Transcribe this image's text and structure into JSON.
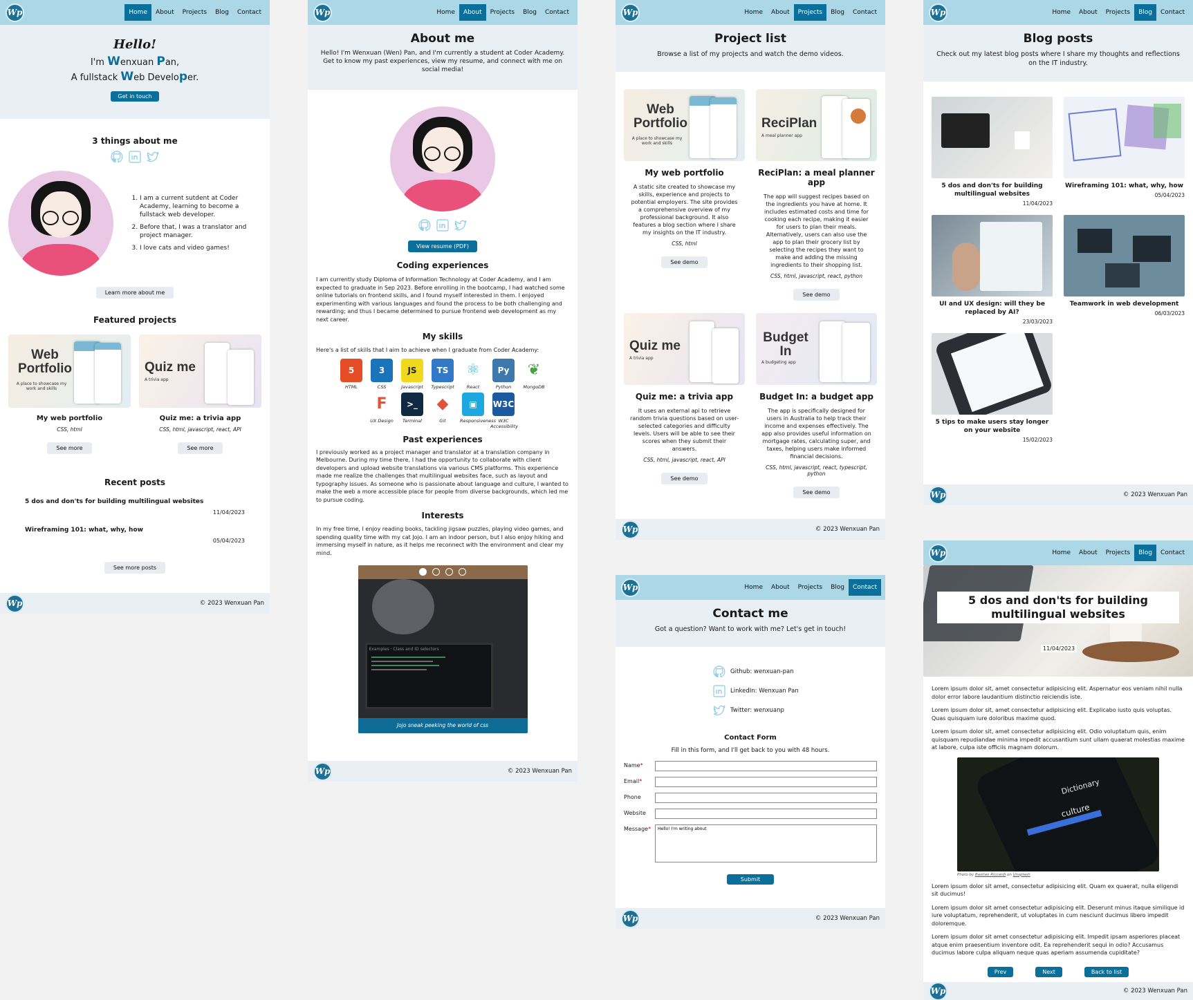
{
  "nav": {
    "home": "Home",
    "about": "About",
    "projects": "Projects",
    "blog": "Blog",
    "contact": "Contact",
    "logo": "Wp"
  },
  "footer_text": "© 2023 Wenxuan Pan",
  "home": {
    "hello": "Hello!",
    "line1_pre": "I'm ",
    "line1_W": "W",
    "line1_mid": "enxuan ",
    "line1_P": "P",
    "line1_post": "an,",
    "line2_pre": "A fullstack ",
    "line2_W": "W",
    "line2_mid": "eb Develo",
    "line2_P": "p",
    "line2_post": "er.",
    "cta": "Get in touch",
    "things_title": "3 things about me",
    "things": [
      "I am a current sutdent at Coder Academy, learning to become a fullstack web developer.",
      "Before that, I was a translator and project manager.",
      "I love cats and video games!"
    ],
    "learn_more": "Learn more about me",
    "featured_title": "Featured projects",
    "featured": [
      {
        "img_title": "Web Portfolio",
        "img_tag": "A place to showcase my work and skills",
        "name": "My web portfolio",
        "tech": "CSS, html",
        "btn": "See more"
      },
      {
        "img_title": "Quiz me",
        "img_tag": "A trivia app",
        "name": "Quiz me: a trivia app",
        "tech": "CSS, html, javascript, react, API",
        "btn": "See more"
      }
    ],
    "recent_title": "Recent posts",
    "recent": [
      {
        "title": "5 dos and don'ts for building multilingual websites",
        "date": "11/04/2023"
      },
      {
        "title": "Wireframing 101: what, why, how",
        "date": "05/04/2023"
      }
    ],
    "see_more_posts": "See more posts"
  },
  "about": {
    "title": "About me",
    "intro": "Hello! I'm Wenxuan (Wen) Pan, and I'm currently a student at Coder Academy. Get to know my past experiences, view my resume, and connect with me on social media!",
    "resume_btn": "View resume (PDF)",
    "coding_title": "Coding experiences",
    "coding_text": "I am currently study Diploma of Information Technology at Coder Academy, and I am expected to graduate in Sep 2023. Before enrolling in the bootcamp, I had watched some online tutorials on frontend skills, and I found myself interested in them. I enjoyed experimenting with various languages and found the process to be both challenging and rewarding; and thus I became determined to pursue frontend web development as my next career.",
    "skills_title": "My skills",
    "skills_intro": "Here's a list of skills that I aim to achieve when I graduate from Coder Academy:",
    "skills": [
      {
        "label": "HTML",
        "glyph": "5",
        "color": "#e44d26"
      },
      {
        "label": "CSS",
        "glyph": "3",
        "color": "#1b73ba"
      },
      {
        "label": "Javascript",
        "glyph": "JS",
        "color": "#f0d81d"
      },
      {
        "label": "Typescript",
        "glyph": "TS",
        "color": "#3178c6"
      },
      {
        "label": "React",
        "glyph": "⚛",
        "color": "#ffffff"
      },
      {
        "label": "Python",
        "glyph": "Py",
        "color": "#3d78aa"
      },
      {
        "label": "MongoDB",
        "glyph": "❦",
        "color": "#ffffff"
      },
      {
        "label": "UX Design",
        "glyph": "F",
        "color": "#ffffff"
      },
      {
        "label": "Terminal",
        "glyph": ">_",
        "color": "#102a43"
      },
      {
        "label": "Git",
        "glyph": "◆",
        "color": "#ffffff"
      },
      {
        "label": "Responsiveness",
        "glyph": "▣",
        "color": "#1fa7e0"
      },
      {
        "label": "W3C Accessibility",
        "glyph": "W3C",
        "color": "#1c5aa0"
      }
    ],
    "past_title": "Past experiences",
    "past_text": "I previously worked as a project manager and translator at a translation company in Melbourne. During my time there, I had the opportunity to collaborate with client developers and upload website translations via various CMS platforms. This experience made me realize the challenges that multilingual websites face, such as layout and typography issues. As someone who is passionate about language and culture, I wanted to make the web a more accessible place for people from diverse backgrounds, which led me to pursue coding.",
    "interests_title": "Interests",
    "interests_text": "In my free time, I enjoy reading books, tackling jigsaw puzzles, playing video games, and spending quality time with my cat Jojo. I am an indoor person, but I also enjoy hiking and immersing myself in nature, as it helps me reconnect with the environment and clear my mind.",
    "caption": "Jojo sneak peeking the world of css",
    "photo_screen_text": "Examples · Class and ID selectors"
  },
  "projects": {
    "title": "Project list",
    "sub": "Browse a list of my projects and watch the demo videos.",
    "items": [
      {
        "img_title": "Web Portfolio",
        "img_tag": "A place to showcase my work and skills",
        "name": "My web portfolio",
        "desc": "A static site created to showcase my skills, experience and projects to potential employers. The site provides a comprehensive overview of my professional background. It also features a blog section where I share my insights on the IT industry.",
        "tech": "CSS, html",
        "btn": "See demo"
      },
      {
        "img_title": "ReciPlan",
        "img_tag": "A meal planner app",
        "name": "ReciPlan: a meal planner app",
        "desc": "The app will suggest recipes based on the ingredients you have at home. It includes estimated costs and time for cooking each recipe, making it easier for users to plan their meals. Alternatively, users can also use the app to plan their grocery list by selecting the recipes they want to make and adding the missing ingredients to their shopping list.",
        "tech": "CSS, html, javascript, react, python",
        "btn": "See demo"
      },
      {
        "img_title": "Quiz me",
        "img_tag": "A trivia app",
        "name": "Quiz me: a trivia app",
        "desc": "It uses an external api to retrieve random trivia questions based on user-selected categories and difficulty levels. Users will be able to see their scores when they submit their answers.",
        "tech": "CSS, html, javascript, react, API",
        "btn": "See demo"
      },
      {
        "img_title": "Budget In",
        "img_tag": "A budgeting app",
        "name": "Budget In: a budget app",
        "desc": "The app is specifically designed for users in Australia to help track their income and expenses effectively. The app also provides useful information on mortgage rates, calculating super, and taxes, helping users make informed financial decisions.",
        "tech": "CSS, html, javascript, react, typescript, python",
        "btn": "See demo"
      }
    ]
  },
  "contact": {
    "title": "Contact me",
    "sub": "Got a question? Want to work with me? Let's get in touch!",
    "github": "Github: wenxuan-pan",
    "linkedin": "LinkedIn: Wenxuan Pan",
    "twitter": "Twitter: wenxuanp",
    "form_title": "Contact Form",
    "form_sub": "Fill in this form, and I'll get back to you with 48 hours.",
    "name": "Name",
    "email": "Email",
    "phone": "Phone",
    "website": "Website",
    "message": "Message",
    "message_value": "Hello! I'm writing about",
    "submit": "Submit"
  },
  "blog": {
    "title": "Blog posts",
    "sub": "Check out my latest blog posts where I share my thoughts and reflections on the IT industry.",
    "posts": [
      {
        "title": "5 dos and don'ts for building multilingual websites",
        "date": "11/04/2023"
      },
      {
        "title": "Wireframing 101: what, why, how",
        "date": "05/04/2023"
      },
      {
        "title": "UI and UX design: will they be replaced by AI?",
        "date": "23/03/2023"
      },
      {
        "title": "Teamwork in web development",
        "date": "06/03/2023"
      },
      {
        "title": "5 tips to make users stay longer on your website",
        "date": "15/02/2023"
      }
    ]
  },
  "post": {
    "title": "5 dos and don'ts for building multilingual websites",
    "date": "11/04/2023",
    "p1": "Lorem ipsum dolor sit, amet consectetur adipisicing elit. Aspernatur eos veniam nihil nulla dolor error labore laudantium distinctio reiciendis iste.",
    "p2": "Lorem ipsum dolor sit, amet consectetur adipisicing elit. Explicabo iusto quis voluptas. Quas quisquam iure doloribus maxime quod.",
    "p3": "Lorem ipsum dolor sit, amet consectetur adipisicing elit. Odio voluptatum quis, enim quisquam repudiandae minima impedit accusantium sunt ullam quaerat molestias maxime at labore, culpa iste officiis magnam dolorum.",
    "photo_text": "Dictionary",
    "photo_word": "culture",
    "credit_pre": "Photo by ",
    "credit_author": "Bastian Riccardi",
    "credit_mid": " on ",
    "credit_site": "Unsplash",
    "p4": "Lorem ipsum dolor sit amet, consectetur adipisicing elit. Quam ex quaerat, nulla eligendi sit ducimus!",
    "p5": "Lorem ipsum dolor sit amet consectetur adipisicing elit. Deserunt minus itaque similique id iure voluptatum, reprehenderit, ut voluptates in cum nesciunt ducimus libero impedit doloremque.",
    "p6": "Lorem ipsum dolor sit amet consectetur adipisicing elit. Impedit ipsam asperiores placeat atque enim praesentium inventore odit. Ea reprehenderit sequi in odio? Accusamus ducimus labore culpa aliquam neque quas aperiam assumenda cupiditate?",
    "prev": "Prev",
    "next": "Next",
    "back": "Back to list"
  }
}
